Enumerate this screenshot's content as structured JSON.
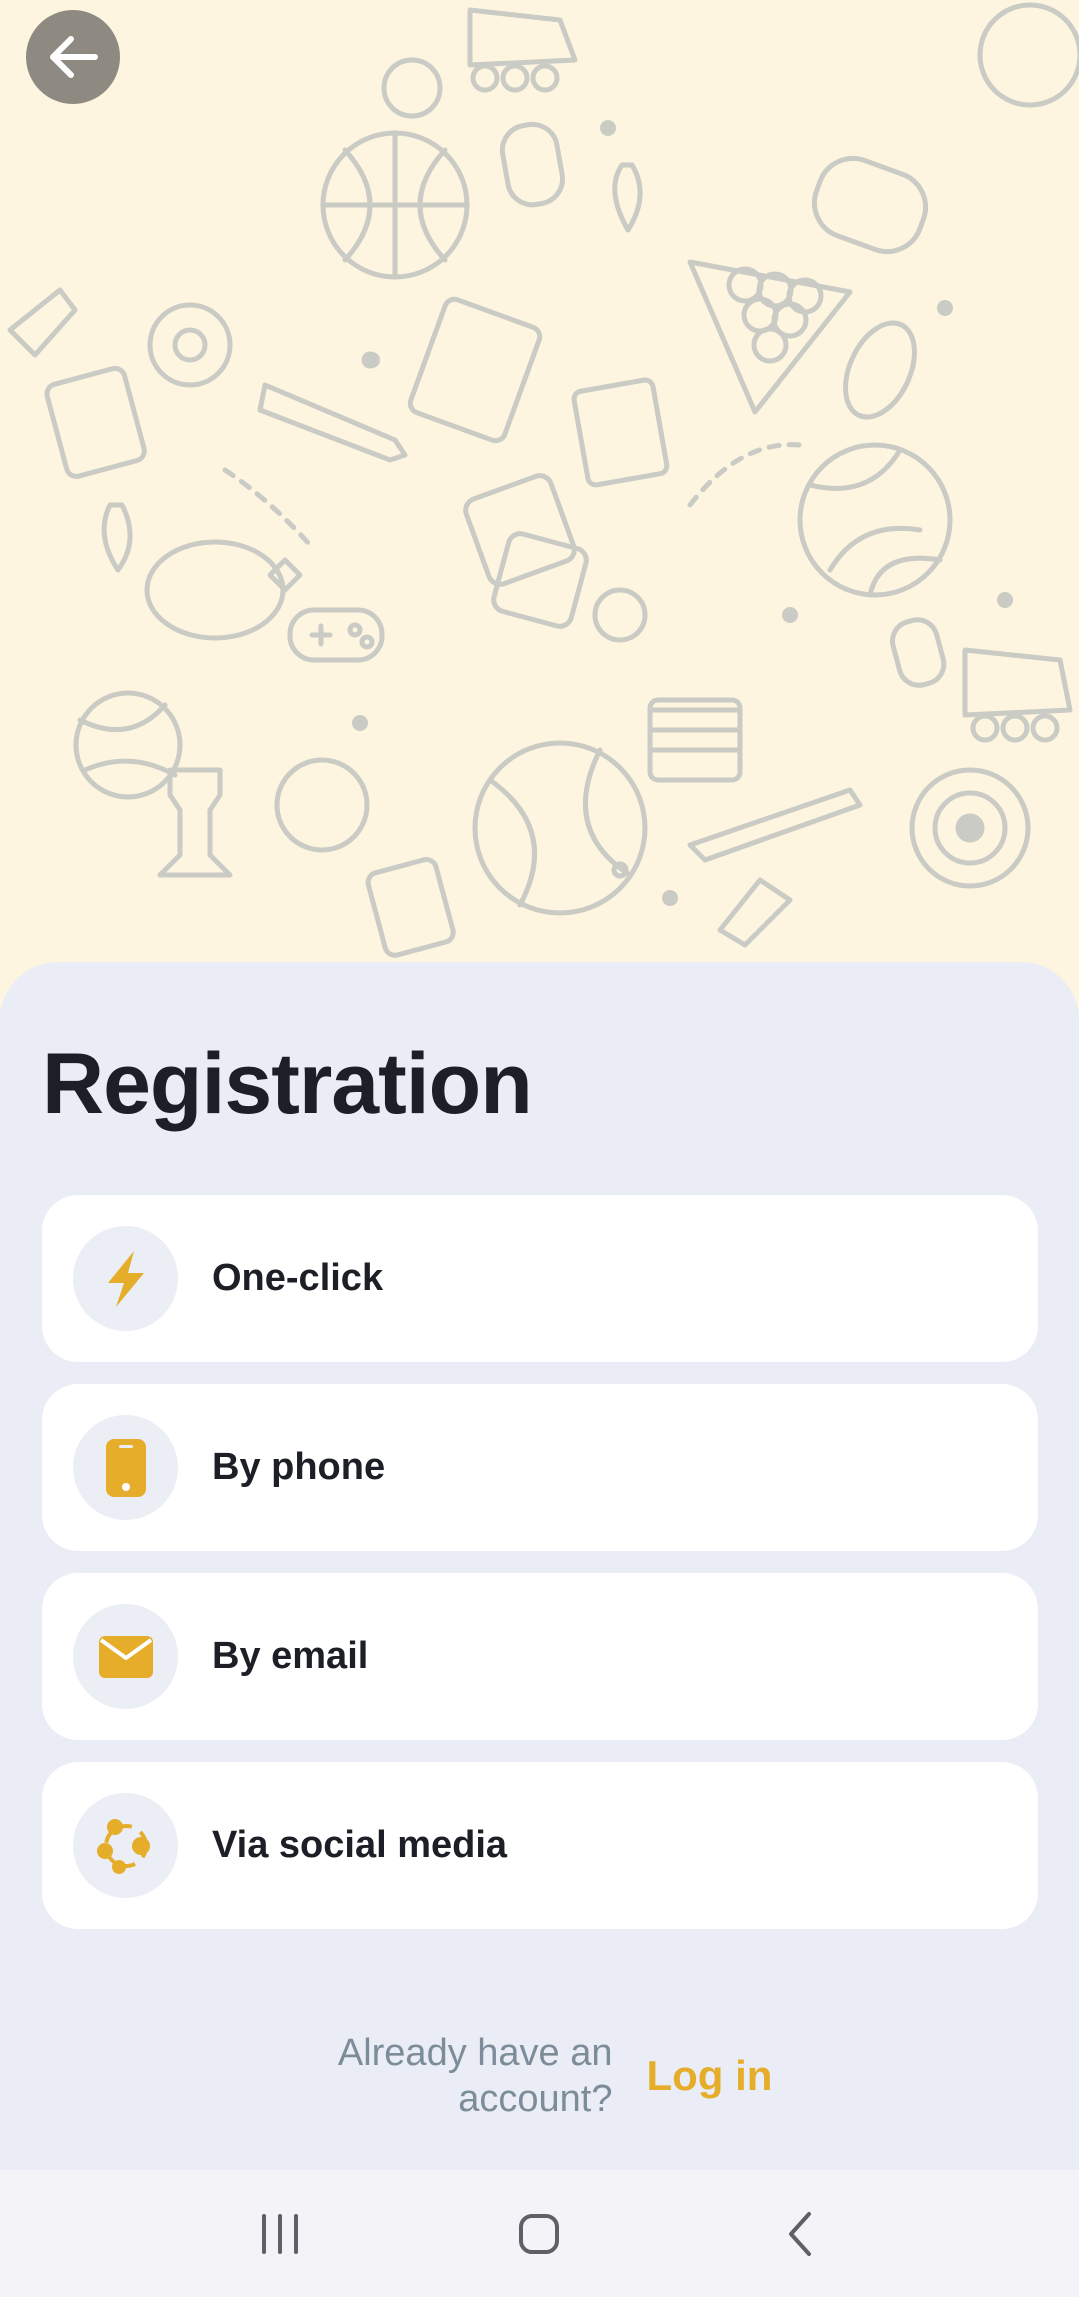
{
  "page": {
    "title": "Registration"
  },
  "header": {
    "back_icon": "arrow-left-icon"
  },
  "options": [
    {
      "label": "One-click",
      "icon": "lightning-icon"
    },
    {
      "label": "By phone",
      "icon": "phone-icon"
    },
    {
      "label": "By email",
      "icon": "envelope-icon"
    },
    {
      "label": "Via social media",
      "icon": "social-network-icon"
    }
  ],
  "footer": {
    "already_text": "Already have an account?",
    "login_label": "Log in"
  },
  "system_nav": {
    "recents_icon": "recents-icon",
    "home_icon": "home-icon",
    "back_icon": "back-chevron-icon"
  },
  "colors": {
    "accent": "#e6ad2b",
    "background": "#eaedf5",
    "hero_bg": "#fdf5df",
    "text": "#1c1f26",
    "muted": "#7c8d99"
  }
}
